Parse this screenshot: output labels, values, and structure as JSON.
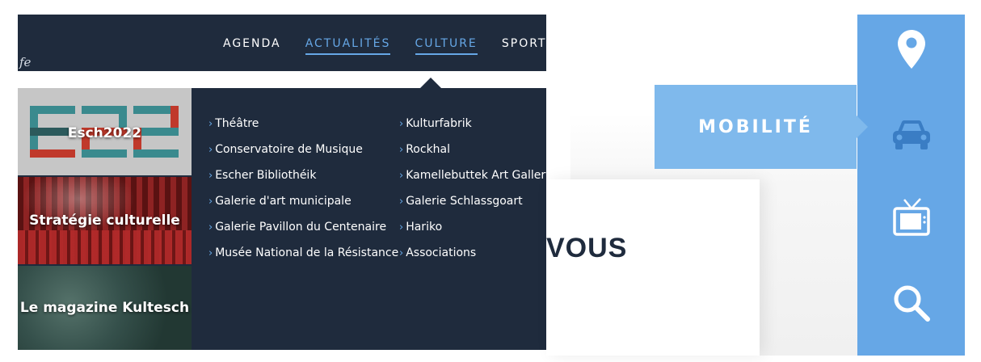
{
  "header": {
    "brand_fragment": "fe",
    "nav": [
      {
        "label": "AGENDA",
        "active": false
      },
      {
        "label": "ACTUALITÉS",
        "active": true
      },
      {
        "label": "CULTURE",
        "active": true
      },
      {
        "label": "SPORT & F"
      }
    ]
  },
  "mega_menu": {
    "tiles": [
      {
        "label": "Esch2022"
      },
      {
        "label": "Stratégie culturelle"
      },
      {
        "label": "Le magazine Kultesch"
      }
    ],
    "column_1": [
      "Théâtre",
      "Conservatoire de Musique",
      "Escher Bibliothéik",
      "Galerie d'art municipale",
      "Galerie Pavillon du Centenaire",
      "Musée National de la Résistance"
    ],
    "column_2": [
      "Kulturfabrik",
      "Rockhal",
      "Kamellebuttek Art Gallery",
      "Galerie Schlassgoart",
      "Hariko",
      "Associations"
    ]
  },
  "content": {
    "heading_fragment": "VOUS"
  },
  "sidebar": {
    "tooltip": "MOBILITÉ",
    "icons": [
      "location-pin-icon",
      "car-icon",
      "tv-icon",
      "search-icon"
    ]
  },
  "colors": {
    "navy": "#1f2b3d",
    "accent_blue": "#66a7e6",
    "tooltip_blue": "#7fb9ec"
  }
}
